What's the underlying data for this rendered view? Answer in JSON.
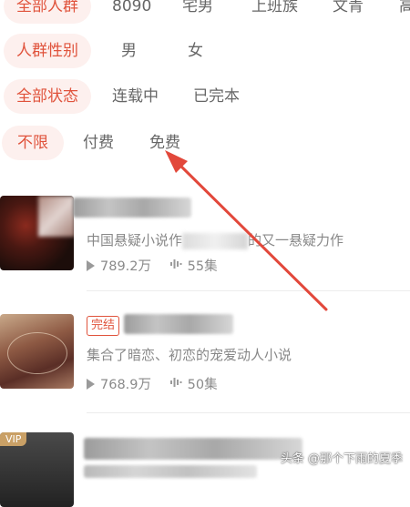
{
  "filters": {
    "crowd": {
      "active": "全部人群",
      "options": [
        "8090",
        "宅男",
        "上班族",
        "文青",
        "高"
      ]
    },
    "gender": {
      "active": "人群性别",
      "options": [
        "男",
        "女"
      ]
    },
    "status": {
      "active": "全部状态",
      "options": [
        "连载中",
        "已完本"
      ]
    },
    "price": {
      "active": "不限",
      "options": [
        "付费",
        "免费"
      ]
    }
  },
  "books": [
    {
      "desc": "中国悬疑小说作",
      "desc2": "的又一悬疑力作",
      "plays": "789.2万",
      "episodes": "55集"
    },
    {
      "badge": "完结",
      "desc": "集合了暗恋、初恋的宠爱动人小说",
      "plays": "768.9万",
      "episodes": "50集"
    },
    {
      "vip": "VIP"
    }
  ],
  "colors": {
    "accent": "#e0533c",
    "arrow": "#e2483b"
  },
  "watermark": "头条 @那个下雨的夏季"
}
